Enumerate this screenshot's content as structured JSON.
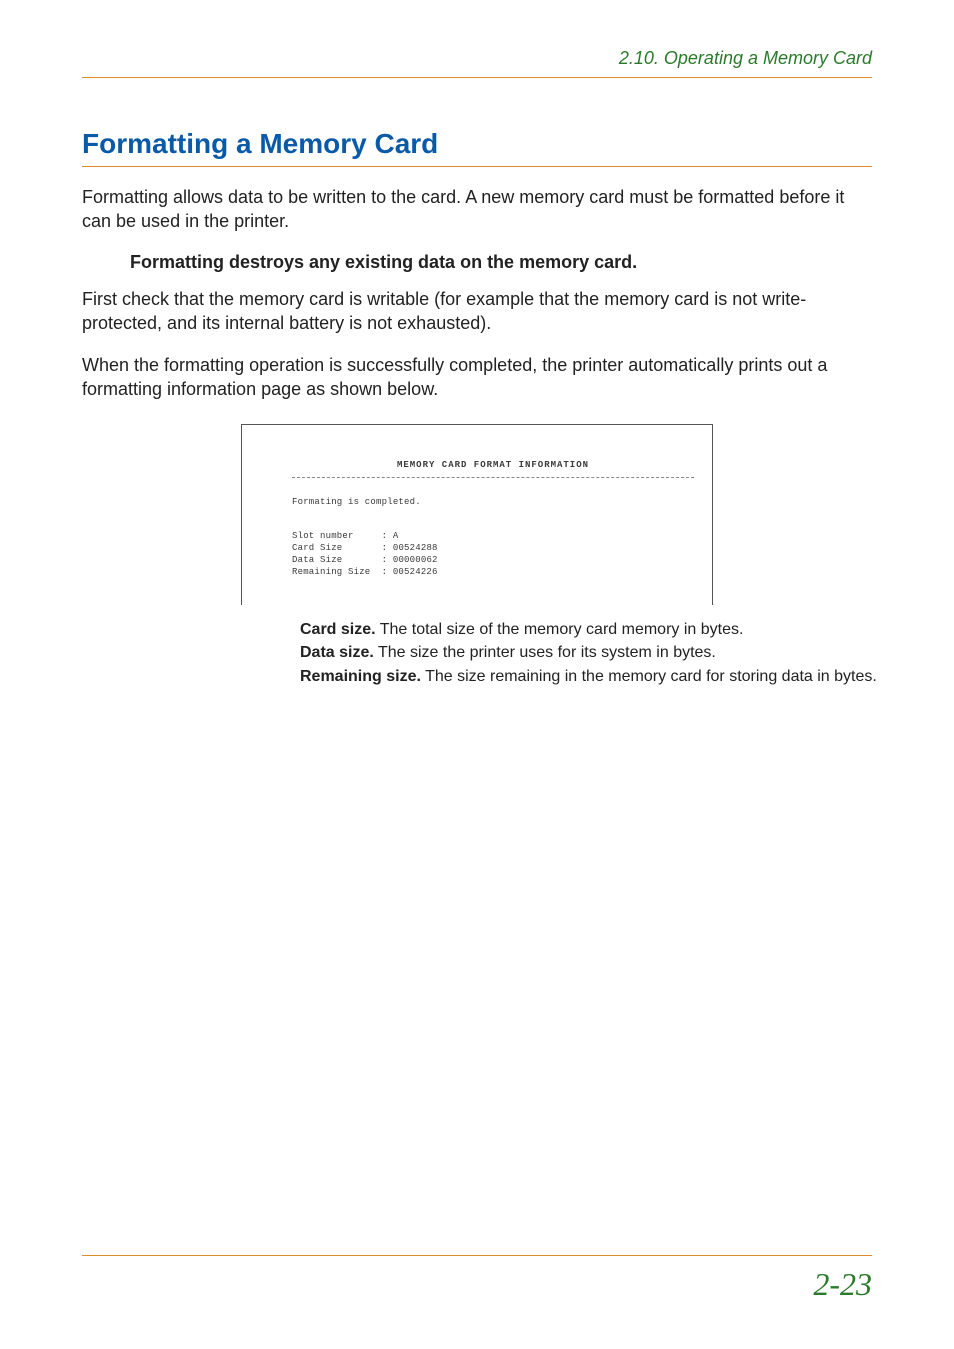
{
  "header": {
    "section": "2.10. Operating a Memory Card"
  },
  "title": "Formatting a Memory Card",
  "para1": "Formatting allows data to be written to the card. A new memory card must be formatted before it can be used in the printer.",
  "warning": "Formatting destroys any existing data on the memory card.",
  "para2": "First check that the memory card is writable (for example that the memory card is not write-protected, and its internal battery is not exhausted).",
  "para3": "When the formatting operation is successfully completed, the printer automatically prints out a formatting information page as shown below.",
  "sample": {
    "title": "MEMORY CARD   FORMAT   INFORMATION",
    "completed": "Formating is completed.",
    "rows": [
      {
        "label": "Slot number",
        "value": ": A"
      },
      {
        "label": "Card Size",
        "value": ": 00524288"
      },
      {
        "label": "Data Size",
        "value": ": 00000062"
      },
      {
        "label": "Remaining Size",
        "value": ": 00524226"
      }
    ]
  },
  "definitions": [
    {
      "term": "Card size.",
      "desc": " The total size of the memory card memory in bytes."
    },
    {
      "term": "Data size.",
      "desc": " The size the printer uses for its system in bytes."
    },
    {
      "term": "Remaining size.",
      "desc": " The size remaining in the memory card for storing data in bytes."
    }
  ],
  "page_number": "2-23"
}
